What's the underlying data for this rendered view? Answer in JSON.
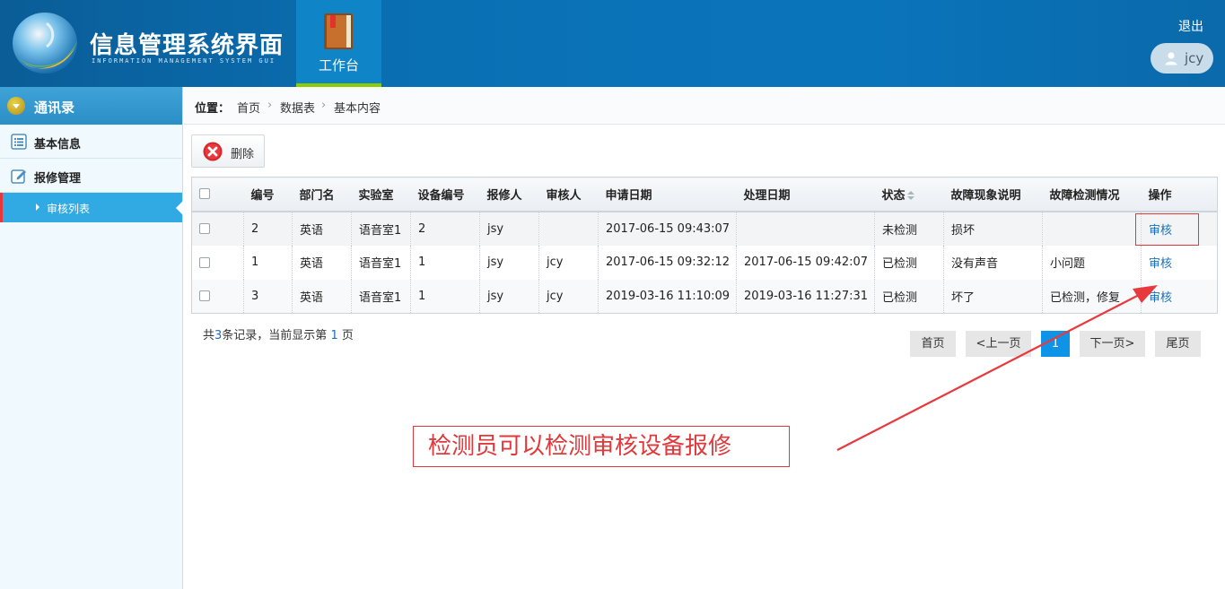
{
  "header": {
    "title": "信息管理系统界面",
    "subtitle": "INFORMATION MANAGEMENT SYSTEM GUI",
    "work_tab": "工作台",
    "logout": "退出",
    "user": "jcy"
  },
  "sidebar": {
    "section": "通讯录",
    "items": [
      {
        "label": "基本信息",
        "icon": "list-icon"
      },
      {
        "label": "报修管理",
        "icon": "edit-icon"
      }
    ],
    "sub_item": "审核列表"
  },
  "breadcrumb": {
    "label": "位置：",
    "items": [
      "首页",
      "数据表",
      "基本内容"
    ]
  },
  "toolbar": {
    "delete_label": "删除"
  },
  "table": {
    "columns": [
      "",
      "编号",
      "部门名",
      "实验室",
      "设备编号",
      "报修人",
      "审核人",
      "申请日期",
      "处理日期",
      "状态",
      "故障现象说明",
      "故障检测情况",
      "操作"
    ],
    "rows": [
      {
        "id": "2",
        "dept": "英语",
        "lab": "语音室1",
        "device": "2",
        "reporter": "jsy",
        "auditor": "",
        "apply_date": "2017-06-15 09:43:07",
        "handle_date": "",
        "status": "未检测",
        "symptom": "损坏",
        "check": "",
        "action": "审核"
      },
      {
        "id": "1",
        "dept": "英语",
        "lab": "语音室1",
        "device": "1",
        "reporter": "jsy",
        "auditor": "jcy",
        "apply_date": "2017-06-15 09:32:12",
        "handle_date": "2017-06-15 09:42:07",
        "status": "已检测",
        "symptom": "没有声音",
        "check": "小问题",
        "action": "审核"
      },
      {
        "id": "3",
        "dept": "英语",
        "lab": "语音室1",
        "device": "1",
        "reporter": "jsy",
        "auditor": "jcy",
        "apply_date": "2019-03-16 11:10:09",
        "handle_date": "2019-03-16 11:27:31",
        "status": "已检测",
        "symptom": "坏了",
        "check": "已检测，修复",
        "action": "审核"
      }
    ]
  },
  "summary": {
    "prefix": "共",
    "count": "3",
    "middle": "条记录，当前显示第",
    "page": "1",
    "suffix": "页"
  },
  "pagination": {
    "first": "首页",
    "prev": "<上一页",
    "current": "1",
    "next": "下一页>",
    "last": "尾页"
  },
  "annotation": {
    "text": "检测员可以检测审核设备报修",
    "color": "#e0393b"
  },
  "colors": {
    "header_blue": "#0a70b4",
    "accent_green": "#8ccd00",
    "sidebar_active": "#31aae3",
    "link_blue": "#1c6fb9",
    "page_active": "#0f93e6"
  }
}
